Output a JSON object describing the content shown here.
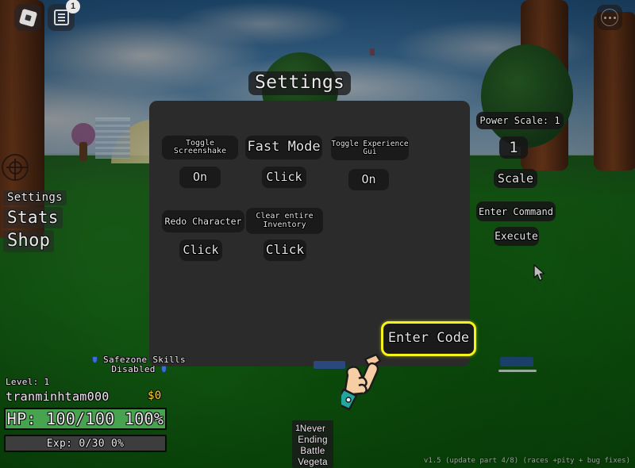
{
  "topbar": {
    "roblox_logo_icon": "roblox-logo-icon",
    "chat_icon": "chat-icon",
    "chat_badge": "1",
    "more_icon": "more-dots-icon"
  },
  "sidemenu": {
    "icon": "target-crosshair-icon",
    "items": [
      {
        "label": "Settings"
      },
      {
        "label": "Stats"
      },
      {
        "label": "Shop"
      }
    ]
  },
  "settings_panel": {
    "title": "Settings",
    "options": [
      {
        "name": "Toggle Screenshake",
        "value": "On"
      },
      {
        "name": "Fast Mode",
        "value": "Click"
      },
      {
        "name": "Toggle Experience Gui",
        "value": "On"
      },
      {
        "name": "Redo Character",
        "value": "Click"
      },
      {
        "name": "Clear entire Inventory",
        "value": "Click"
      }
    ],
    "enter_code_label": "Enter Code",
    "highlight_color": "#f5f31a",
    "panel_color": "#2b2b2b",
    "button_color": "#1a1a1a"
  },
  "right_panel": {
    "power_scale_label": "Power Scale: 1",
    "power_scale_value": "1",
    "scale_button": "Scale",
    "enter_command_label": "Enter Command",
    "execute_button": "Execute"
  },
  "hud": {
    "safezone_line1": "Safezone Skills",
    "safezone_line2": "Disabled",
    "level": "Level: 1",
    "player_name": "tranminhtam000",
    "money": "$0",
    "money_color": "#f2d02a",
    "hp_text": "HP: 100/100 100%",
    "hp_color": "#48a350",
    "exp_text": "Exp: 0/30 0%"
  },
  "quest": {
    "number": "1",
    "lines": [
      "Never",
      "Ending",
      "Battle",
      "Vegeta"
    ]
  },
  "version": "v1.5 (update part 4/8) (races +pity + bug fixes)",
  "cursors": {
    "hand_pointer": "pointing-hand-cursor",
    "mouse_arrow": "mouse-arrow-cursor"
  }
}
